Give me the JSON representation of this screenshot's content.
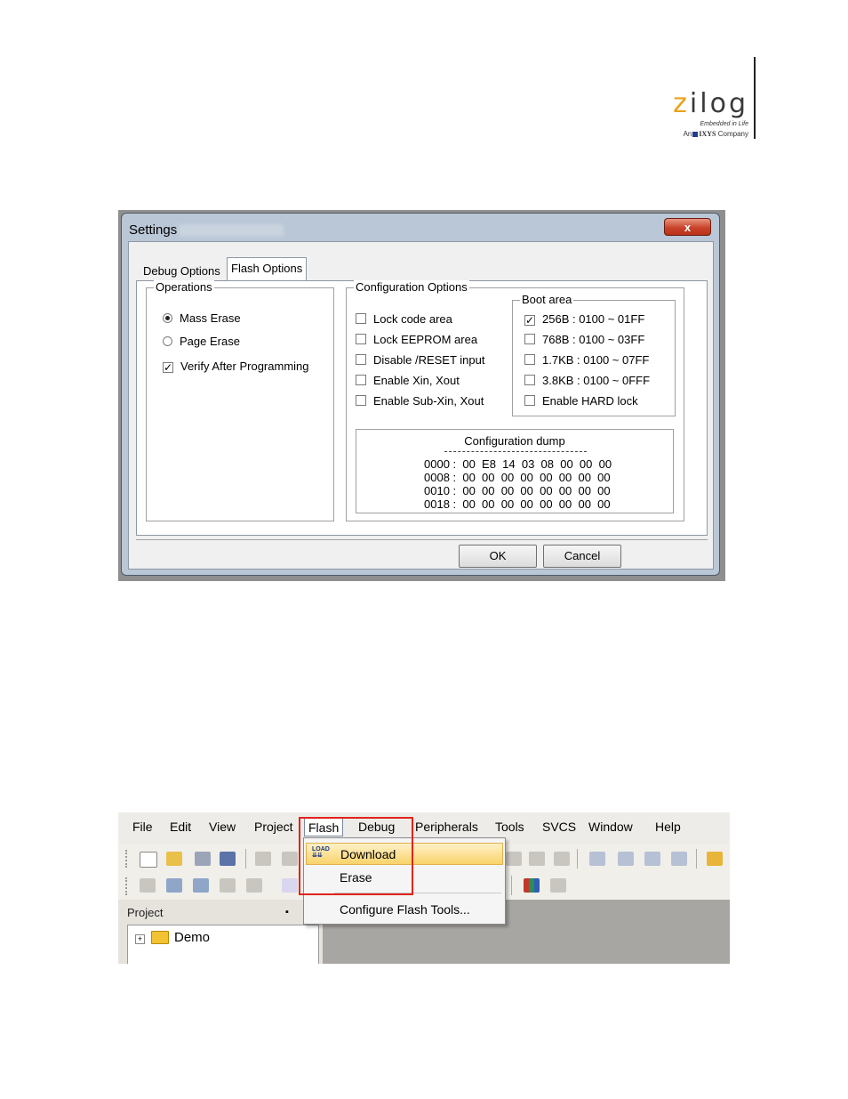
{
  "logo": {
    "brand": "zilog",
    "tagline": "Embedded in Life",
    "ixys_prefix": "An",
    "ixys_name": "IXYS",
    "ixys_suffix": "Company"
  },
  "settings_dialog": {
    "title": "Settings",
    "close_glyph": "x",
    "tabs": [
      "Debug Options",
      "Flash Options"
    ],
    "active_tab": "Flash Options",
    "operations": {
      "label": "Operations",
      "mass_erase": "Mass Erase",
      "page_erase": "Page Erase",
      "verify": "Verify After Programming",
      "selected": "Mass Erase",
      "verify_checked": true
    },
    "configuration": {
      "label": "Configuration Options",
      "lock_code": "Lock code area",
      "lock_eeprom": "Lock EEPROM area",
      "disable_reset": "Disable /RESET input",
      "enable_xin": "Enable Xin, Xout",
      "enable_subxin": "Enable Sub-Xin, Xout"
    },
    "boot_area": {
      "label": "Boot area",
      "b256": "256B : 0100 ~ 01FF",
      "b768": "768B : 0100 ~ 03FF",
      "b1k7": "1.7KB : 0100 ~ 07FF",
      "b3k8": "3.8KB : 0100 ~ 0FFF",
      "hard_lock": "Enable HARD lock",
      "checked": "256B : 0100 ~ 01FF"
    },
    "dump": {
      "title": "Configuration dump",
      "row0": "0000 :  00  E8  14  03  08  00  00  00",
      "row1": "0008 :  00  00  00  00  00  00  00  00",
      "row2": "0010 :  00  00  00  00  00  00  00  00",
      "row3": "0018 :  00  00  00  00  00  00  00  00"
    },
    "ok": "OK",
    "cancel": "Cancel"
  },
  "ide": {
    "menu": {
      "file": "File",
      "edit": "Edit",
      "view": "View",
      "project": "Project",
      "flash": "Flash",
      "debug": "Debug",
      "peripherals": "Peripherals",
      "tools": "Tools",
      "svcs": "SVCS",
      "window": "Window",
      "help": "Help"
    },
    "flash_menu": {
      "download": "Download",
      "erase": "Erase",
      "configure": "Configure Flash Tools...",
      "load_icon_text": "LOAD"
    },
    "project_pane": {
      "label": "Project",
      "root": "Demo"
    },
    "highlight_color": "#e0241b"
  }
}
